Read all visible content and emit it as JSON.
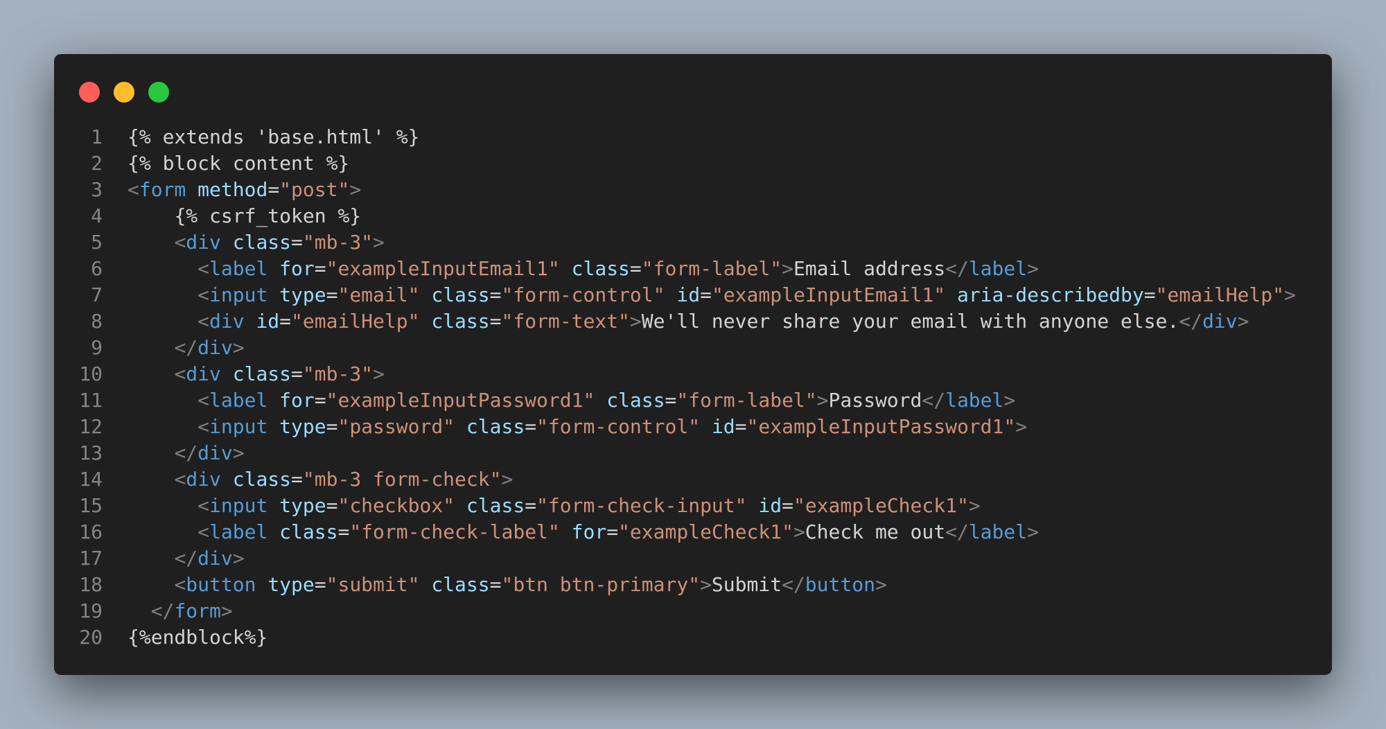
{
  "window": {
    "dots": [
      {
        "name": "close-dot",
        "color": "#ff5f57"
      },
      {
        "name": "minimize-dot",
        "color": "#febc2e"
      },
      {
        "name": "zoom-dot",
        "color": "#28c840"
      }
    ]
  },
  "colors": {
    "background": "#a3b0bd",
    "editor_background": "#1f1f1f",
    "punct": "#808080",
    "tag": "#569cd6",
    "attribute": "#9cdcfe",
    "string": "#ce9178",
    "text": "#d4d4d4",
    "line_number": "#858585"
  },
  "code": {
    "lines": [
      {
        "n": "1",
        "tokens": [
          {
            "t": "tpl",
            "v": "{% extends 'base.html' %}"
          }
        ]
      },
      {
        "n": "2",
        "tokens": [
          {
            "t": "tpl",
            "v": "{% block content %}"
          }
        ]
      },
      {
        "n": "3",
        "tokens": [
          {
            "t": "punct",
            "v": "<"
          },
          {
            "t": "tag",
            "v": "form"
          },
          {
            "t": "text",
            "v": " "
          },
          {
            "t": "attr",
            "v": "method"
          },
          {
            "t": "eq",
            "v": "="
          },
          {
            "t": "str",
            "v": "\"post\""
          },
          {
            "t": "punct",
            "v": ">"
          }
        ]
      },
      {
        "n": "4",
        "tokens": [
          {
            "t": "text",
            "v": "    "
          },
          {
            "t": "tpl",
            "v": "{% csrf_token %}"
          }
        ]
      },
      {
        "n": "5",
        "tokens": [
          {
            "t": "text",
            "v": "    "
          },
          {
            "t": "punct",
            "v": "<"
          },
          {
            "t": "tag",
            "v": "div"
          },
          {
            "t": "text",
            "v": " "
          },
          {
            "t": "attr",
            "v": "class"
          },
          {
            "t": "eq",
            "v": "="
          },
          {
            "t": "str",
            "v": "\"mb-3\""
          },
          {
            "t": "punct",
            "v": ">"
          }
        ]
      },
      {
        "n": "6",
        "tokens": [
          {
            "t": "text",
            "v": "      "
          },
          {
            "t": "punct",
            "v": "<"
          },
          {
            "t": "tag",
            "v": "label"
          },
          {
            "t": "text",
            "v": " "
          },
          {
            "t": "attr",
            "v": "for"
          },
          {
            "t": "eq",
            "v": "="
          },
          {
            "t": "str",
            "v": "\"exampleInputEmail1\""
          },
          {
            "t": "text",
            "v": " "
          },
          {
            "t": "attr",
            "v": "class"
          },
          {
            "t": "eq",
            "v": "="
          },
          {
            "t": "str",
            "v": "\"form-label\""
          },
          {
            "t": "punct",
            "v": ">"
          },
          {
            "t": "text",
            "v": "Email address"
          },
          {
            "t": "punct",
            "v": "</"
          },
          {
            "t": "tag",
            "v": "label"
          },
          {
            "t": "punct",
            "v": ">"
          }
        ]
      },
      {
        "n": "7",
        "tokens": [
          {
            "t": "text",
            "v": "      "
          },
          {
            "t": "punct",
            "v": "<"
          },
          {
            "t": "tag",
            "v": "input"
          },
          {
            "t": "text",
            "v": " "
          },
          {
            "t": "attr",
            "v": "type"
          },
          {
            "t": "eq",
            "v": "="
          },
          {
            "t": "str",
            "v": "\"email\""
          },
          {
            "t": "text",
            "v": " "
          },
          {
            "t": "attr",
            "v": "class"
          },
          {
            "t": "eq",
            "v": "="
          },
          {
            "t": "str",
            "v": "\"form-control\""
          },
          {
            "t": "text",
            "v": " "
          },
          {
            "t": "attr",
            "v": "id"
          },
          {
            "t": "eq",
            "v": "="
          },
          {
            "t": "str",
            "v": "\"exampleInputEmail1\""
          },
          {
            "t": "text",
            "v": " "
          },
          {
            "t": "attr",
            "v": "aria-describedby"
          },
          {
            "t": "eq",
            "v": "="
          },
          {
            "t": "str",
            "v": "\"emailHelp\""
          },
          {
            "t": "punct",
            "v": ">"
          }
        ]
      },
      {
        "n": "8",
        "tokens": [
          {
            "t": "text",
            "v": "      "
          },
          {
            "t": "punct",
            "v": "<"
          },
          {
            "t": "tag",
            "v": "div"
          },
          {
            "t": "text",
            "v": " "
          },
          {
            "t": "attr",
            "v": "id"
          },
          {
            "t": "eq",
            "v": "="
          },
          {
            "t": "str",
            "v": "\"emailHelp\""
          },
          {
            "t": "text",
            "v": " "
          },
          {
            "t": "attr",
            "v": "class"
          },
          {
            "t": "eq",
            "v": "="
          },
          {
            "t": "str",
            "v": "\"form-text\""
          },
          {
            "t": "punct",
            "v": ">"
          },
          {
            "t": "text",
            "v": "We'll never share your email with anyone else."
          },
          {
            "t": "punct",
            "v": "</"
          },
          {
            "t": "tag",
            "v": "div"
          },
          {
            "t": "punct",
            "v": ">"
          }
        ]
      },
      {
        "n": "9",
        "tokens": [
          {
            "t": "text",
            "v": "    "
          },
          {
            "t": "punct",
            "v": "</"
          },
          {
            "t": "tag",
            "v": "div"
          },
          {
            "t": "punct",
            "v": ">"
          }
        ]
      },
      {
        "n": "10",
        "tokens": [
          {
            "t": "text",
            "v": "    "
          },
          {
            "t": "punct",
            "v": "<"
          },
          {
            "t": "tag",
            "v": "div"
          },
          {
            "t": "text",
            "v": " "
          },
          {
            "t": "attr",
            "v": "class"
          },
          {
            "t": "eq",
            "v": "="
          },
          {
            "t": "str",
            "v": "\"mb-3\""
          },
          {
            "t": "punct",
            "v": ">"
          }
        ]
      },
      {
        "n": "11",
        "tokens": [
          {
            "t": "text",
            "v": "      "
          },
          {
            "t": "punct",
            "v": "<"
          },
          {
            "t": "tag",
            "v": "label"
          },
          {
            "t": "text",
            "v": " "
          },
          {
            "t": "attr",
            "v": "for"
          },
          {
            "t": "eq",
            "v": "="
          },
          {
            "t": "str",
            "v": "\"exampleInputPassword1\""
          },
          {
            "t": "text",
            "v": " "
          },
          {
            "t": "attr",
            "v": "class"
          },
          {
            "t": "eq",
            "v": "="
          },
          {
            "t": "str",
            "v": "\"form-label\""
          },
          {
            "t": "punct",
            "v": ">"
          },
          {
            "t": "text",
            "v": "Password"
          },
          {
            "t": "punct",
            "v": "</"
          },
          {
            "t": "tag",
            "v": "label"
          },
          {
            "t": "punct",
            "v": ">"
          }
        ]
      },
      {
        "n": "12",
        "tokens": [
          {
            "t": "text",
            "v": "      "
          },
          {
            "t": "punct",
            "v": "<"
          },
          {
            "t": "tag",
            "v": "input"
          },
          {
            "t": "text",
            "v": " "
          },
          {
            "t": "attr",
            "v": "type"
          },
          {
            "t": "eq",
            "v": "="
          },
          {
            "t": "str",
            "v": "\"password\""
          },
          {
            "t": "text",
            "v": " "
          },
          {
            "t": "attr",
            "v": "class"
          },
          {
            "t": "eq",
            "v": "="
          },
          {
            "t": "str",
            "v": "\"form-control\""
          },
          {
            "t": "text",
            "v": " "
          },
          {
            "t": "attr",
            "v": "id"
          },
          {
            "t": "eq",
            "v": "="
          },
          {
            "t": "str",
            "v": "\"exampleInputPassword1\""
          },
          {
            "t": "punct",
            "v": ">"
          }
        ]
      },
      {
        "n": "13",
        "tokens": [
          {
            "t": "text",
            "v": "    "
          },
          {
            "t": "punct",
            "v": "</"
          },
          {
            "t": "tag",
            "v": "div"
          },
          {
            "t": "punct",
            "v": ">"
          }
        ]
      },
      {
        "n": "14",
        "tokens": [
          {
            "t": "text",
            "v": "    "
          },
          {
            "t": "punct",
            "v": "<"
          },
          {
            "t": "tag",
            "v": "div"
          },
          {
            "t": "text",
            "v": " "
          },
          {
            "t": "attr",
            "v": "class"
          },
          {
            "t": "eq",
            "v": "="
          },
          {
            "t": "str",
            "v": "\"mb-3 form-check\""
          },
          {
            "t": "punct",
            "v": ">"
          }
        ]
      },
      {
        "n": "15",
        "tokens": [
          {
            "t": "text",
            "v": "      "
          },
          {
            "t": "punct",
            "v": "<"
          },
          {
            "t": "tag",
            "v": "input"
          },
          {
            "t": "text",
            "v": " "
          },
          {
            "t": "attr",
            "v": "type"
          },
          {
            "t": "eq",
            "v": "="
          },
          {
            "t": "str",
            "v": "\"checkbox\""
          },
          {
            "t": "text",
            "v": " "
          },
          {
            "t": "attr",
            "v": "class"
          },
          {
            "t": "eq",
            "v": "="
          },
          {
            "t": "str",
            "v": "\"form-check-input\""
          },
          {
            "t": "text",
            "v": " "
          },
          {
            "t": "attr",
            "v": "id"
          },
          {
            "t": "eq",
            "v": "="
          },
          {
            "t": "str",
            "v": "\"exampleCheck1\""
          },
          {
            "t": "punct",
            "v": ">"
          }
        ]
      },
      {
        "n": "16",
        "tokens": [
          {
            "t": "text",
            "v": "      "
          },
          {
            "t": "punct",
            "v": "<"
          },
          {
            "t": "tag",
            "v": "label"
          },
          {
            "t": "text",
            "v": " "
          },
          {
            "t": "attr",
            "v": "class"
          },
          {
            "t": "eq",
            "v": "="
          },
          {
            "t": "str",
            "v": "\"form-check-label\""
          },
          {
            "t": "text",
            "v": " "
          },
          {
            "t": "attr",
            "v": "for"
          },
          {
            "t": "eq",
            "v": "="
          },
          {
            "t": "str",
            "v": "\"exampleCheck1\""
          },
          {
            "t": "punct",
            "v": ">"
          },
          {
            "t": "text",
            "v": "Check me out"
          },
          {
            "t": "punct",
            "v": "</"
          },
          {
            "t": "tag",
            "v": "label"
          },
          {
            "t": "punct",
            "v": ">"
          }
        ]
      },
      {
        "n": "17",
        "tokens": [
          {
            "t": "text",
            "v": "    "
          },
          {
            "t": "punct",
            "v": "</"
          },
          {
            "t": "tag",
            "v": "div"
          },
          {
            "t": "punct",
            "v": ">"
          }
        ]
      },
      {
        "n": "18",
        "tokens": [
          {
            "t": "text",
            "v": "    "
          },
          {
            "t": "punct",
            "v": "<"
          },
          {
            "t": "tag",
            "v": "button"
          },
          {
            "t": "text",
            "v": " "
          },
          {
            "t": "attr",
            "v": "type"
          },
          {
            "t": "eq",
            "v": "="
          },
          {
            "t": "str",
            "v": "\"submit\""
          },
          {
            "t": "text",
            "v": " "
          },
          {
            "t": "attr",
            "v": "class"
          },
          {
            "t": "eq",
            "v": "="
          },
          {
            "t": "str",
            "v": "\"btn btn-primary\""
          },
          {
            "t": "punct",
            "v": ">"
          },
          {
            "t": "text",
            "v": "Submit"
          },
          {
            "t": "punct",
            "v": "</"
          },
          {
            "t": "tag",
            "v": "button"
          },
          {
            "t": "punct",
            "v": ">"
          }
        ]
      },
      {
        "n": "19",
        "tokens": [
          {
            "t": "text",
            "v": "  "
          },
          {
            "t": "punct",
            "v": "</"
          },
          {
            "t": "tag",
            "v": "form"
          },
          {
            "t": "punct",
            "v": ">"
          }
        ]
      },
      {
        "n": "20",
        "tokens": [
          {
            "t": "tpl",
            "v": "{%endblock%}"
          }
        ]
      }
    ]
  }
}
